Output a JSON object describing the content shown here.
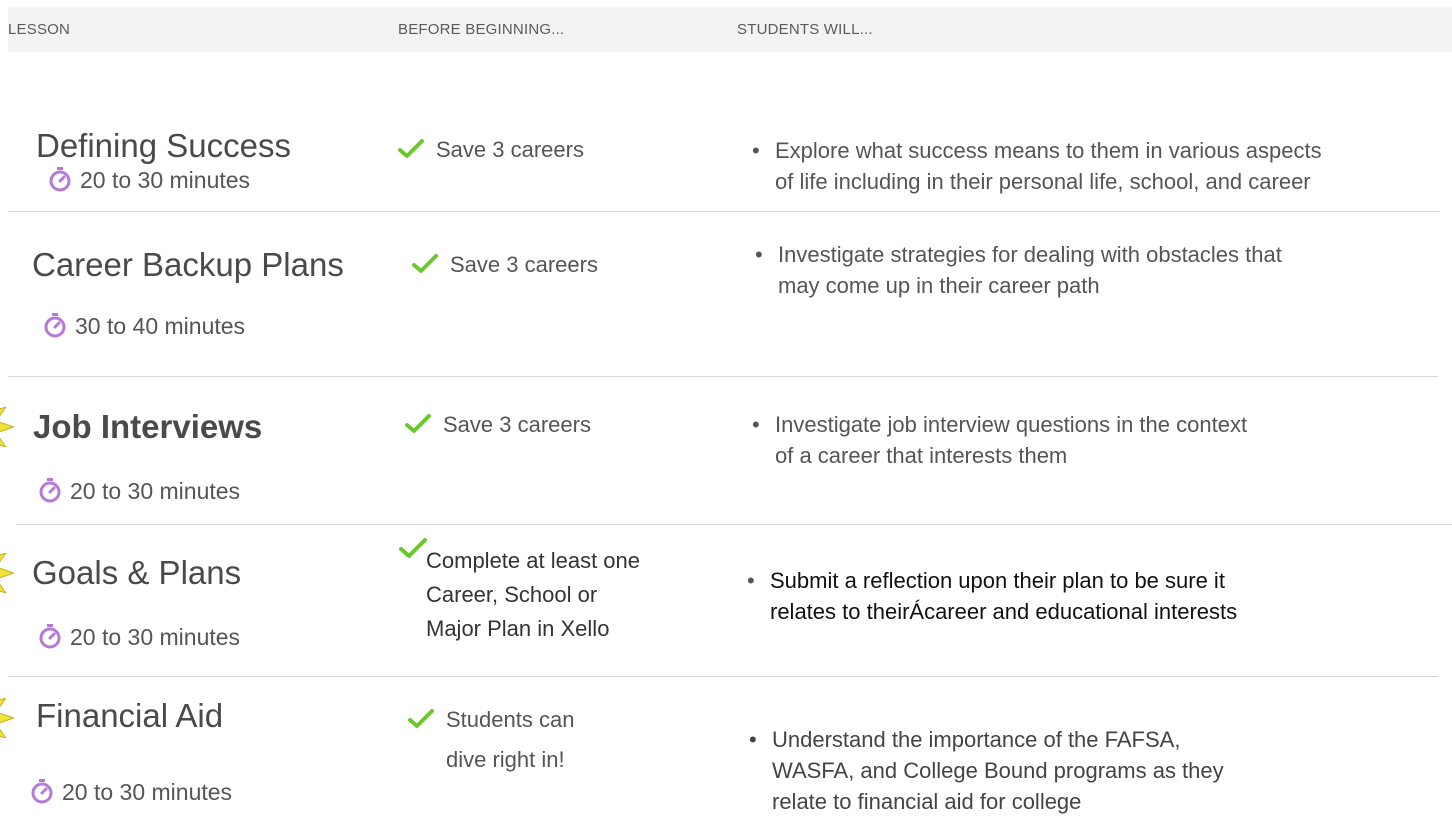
{
  "header": {
    "col_lesson": "LESSON",
    "col_before": "BEFORE BEGINNING...",
    "col_students": "STUDENTS WILL..."
  },
  "colors": {
    "accent_purple": "#b57ad6",
    "check_green": "#6cc72f",
    "star_yellow": "#f3e23a"
  },
  "icons": {
    "duration": "stopwatch-icon",
    "prereq": "check-icon",
    "featured": "star-icon"
  },
  "lessons": [
    {
      "title": "Defining Success",
      "duration": "20 to 30 minutes",
      "prereq": "Save 3 careers",
      "outcome_lines": [
        "Explore what success means to them in various aspects",
        "of life including in their personal life, school, and career"
      ]
    },
    {
      "title": "Career Backup Plans",
      "duration": "30 to 40 minutes",
      "prereq": "Save 3 careers",
      "outcome_lines": [
        "Investigate strategies for dealing with obstacles that",
        "may come up in their career path"
      ]
    },
    {
      "title": "Job Interviews",
      "duration": "20 to 30 minutes",
      "prereq": "Save 3 careers",
      "outcome_lines": [
        "Investigate job interview questions in the context",
        "of a career that interests them"
      ]
    },
    {
      "title": "Goals & Plans",
      "duration": "20 to 30 minutes",
      "prereq_lines": [
        "Complete at least one",
        "Career, School or",
        "Major Plan in Xello"
      ],
      "outcome_lines": [
        "Submit a reflection upon their plan to be sure it",
        "relates to theirÁcareer and educational interests"
      ]
    },
    {
      "title": "Financial Aid",
      "duration": "20 to 30 minutes",
      "prereq_lines": [
        "Students can",
        "dive right in!"
      ],
      "outcome_lines": [
        "Understand the importance of the FAFSA,",
        "WASFA, and College Bound programs as they",
        "relate to financial aid for college"
      ]
    }
  ]
}
